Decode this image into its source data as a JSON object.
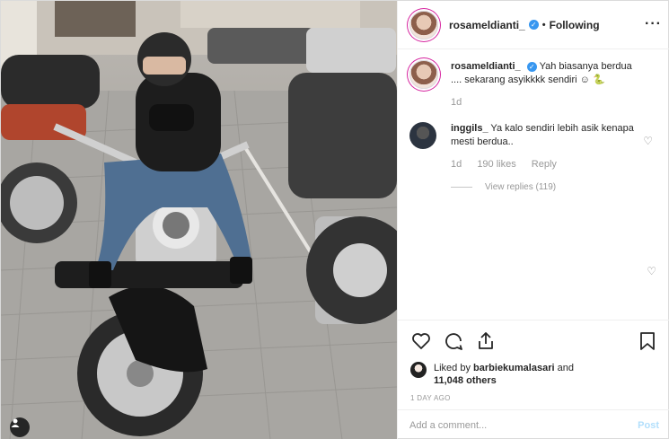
{
  "post": {
    "username": "rosameldianti_",
    "follow_status": "Following",
    "more_icon": "ellipsis-icon"
  },
  "caption": {
    "username": "rosameldianti_",
    "text": "Yah biasanya berdua .... sekarang asyikkkk sendiri ☺ 🐍",
    "age": "1d"
  },
  "comments": [
    {
      "username": "inggils_",
      "text": "Ya kalo sendiri lebih asik kenapa mesti berdua..",
      "age": "1d",
      "likes": "190 likes",
      "reply_label": "Reply",
      "view_replies": "View replies (119)"
    }
  ],
  "actions": {
    "liked_by_prefix": "Liked by",
    "liked_by_user": "barbiekumalasari",
    "liked_by_suffix": "and",
    "others": "11,048 others",
    "posted_ago": "1 DAY AGO"
  },
  "add_comment": {
    "placeholder": "Add a comment...",
    "post_label": "Post"
  },
  "colors": {
    "verified": "#3897f0",
    "post_disabled": "#b2dffc",
    "story_ring": "#d6249f"
  }
}
